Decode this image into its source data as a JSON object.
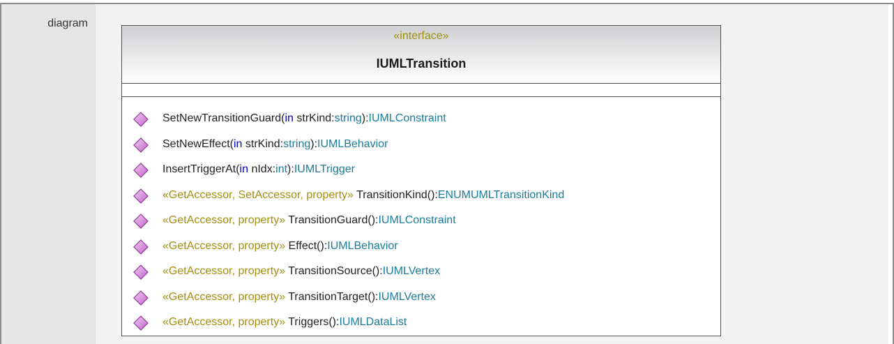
{
  "row_label": "diagram",
  "interface": {
    "stereotype": "«interface»",
    "name": "IUMLTransition"
  },
  "operations": [
    {
      "stereo": "",
      "name": "SetNewTransitionGuard(",
      "kw": "in",
      "param": " strKind:",
      "ptype": "string",
      "close": "):",
      "rtype": "IUMLConstraint"
    },
    {
      "stereo": "",
      "name": "SetNewEffect(",
      "kw": "in",
      "param": " strKind:",
      "ptype": "string",
      "close": "):",
      "rtype": "IUMLBehavior"
    },
    {
      "stereo": "",
      "name": "InsertTriggerAt(",
      "kw": "in",
      "param": " nIdx:",
      "ptype": "int",
      "close": "):",
      "rtype": "IUMLTrigger"
    },
    {
      "stereo": "«GetAccessor, SetAccessor, property»",
      "name": " TransitionKind():",
      "kw": "",
      "param": "",
      "ptype": "",
      "close": "",
      "rtype": "ENUMUMLTransitionKind"
    },
    {
      "stereo": "«GetAccessor, property»",
      "name": " TransitionGuard():",
      "kw": "",
      "param": "",
      "ptype": "",
      "close": "",
      "rtype": "IUMLConstraint"
    },
    {
      "stereo": "«GetAccessor, property»",
      "name": " Effect():",
      "kw": "",
      "param": "",
      "ptype": "",
      "close": "",
      "rtype": "IUMLBehavior"
    },
    {
      "stereo": "«GetAccessor, property»",
      "name": " TransitionSource():",
      "kw": "",
      "param": "",
      "ptype": "",
      "close": "",
      "rtype": "IUMLVertex"
    },
    {
      "stereo": "«GetAccessor, property»",
      "name": " TransitionTarget():",
      "kw": "",
      "param": "",
      "ptype": "",
      "close": "",
      "rtype": "IUMLVertex"
    },
    {
      "stereo": "«GetAccessor, property»",
      "name": " Triggers():",
      "kw": "",
      "param": "",
      "ptype": "",
      "close": "",
      "rtype": "IUMLDataList"
    }
  ],
  "icon_name": "operation-diamond-icon",
  "colors": {
    "stereotype": "#a48e0e",
    "keyword": "#0000cc",
    "type": "#1a7c9a",
    "icon": "#c060c8"
  }
}
